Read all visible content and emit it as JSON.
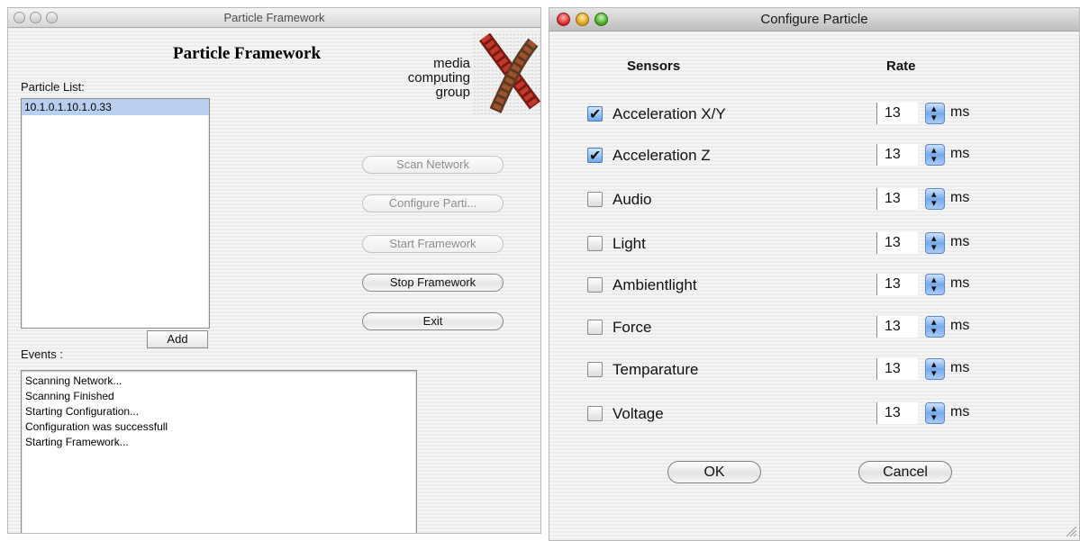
{
  "main_window": {
    "title": "Particle Framework",
    "heading": "Particle Framework",
    "logo_lines": [
      "media",
      "computing",
      "group"
    ],
    "particle_list_label": "Particle List:",
    "particles": [
      "10.1.0.1.10.1.0.33"
    ],
    "add_label": "Add",
    "buttons": {
      "scan": "Scan Network",
      "configure": "Configure Parti...",
      "start": "Start Framework",
      "stop": "Stop Framework",
      "exit": "Exit"
    },
    "events_label": "Events :",
    "events": [
      "Scanning Network...",
      "Scanning Finished",
      "Starting Configuration...",
      "Configuration was successfull",
      "Starting Framework..."
    ]
  },
  "config_window": {
    "title": "Configure Particle",
    "sensors_header": "Sensors",
    "rate_header": "Rate",
    "unit": "ms",
    "sensors": [
      {
        "name": "Acceleration X/Y",
        "checked": true,
        "rate": "13"
      },
      {
        "name": "Acceleration Z",
        "checked": true,
        "rate": "13"
      },
      {
        "name": "Audio",
        "checked": false,
        "rate": "13"
      },
      {
        "name": "Light",
        "checked": false,
        "rate": "13"
      },
      {
        "name": "Ambientlight",
        "checked": false,
        "rate": "13"
      },
      {
        "name": "Force",
        "checked": false,
        "rate": "13"
      },
      {
        "name": "Temparature",
        "checked": false,
        "rate": "13"
      },
      {
        "name": "Voltage",
        "checked": false,
        "rate": "13"
      }
    ],
    "ok_label": "OK",
    "cancel_label": "Cancel"
  },
  "colors": {
    "selection": "#b8cfef",
    "stepper_blue": "#76a9e9",
    "logo_red": "#b7231c"
  }
}
